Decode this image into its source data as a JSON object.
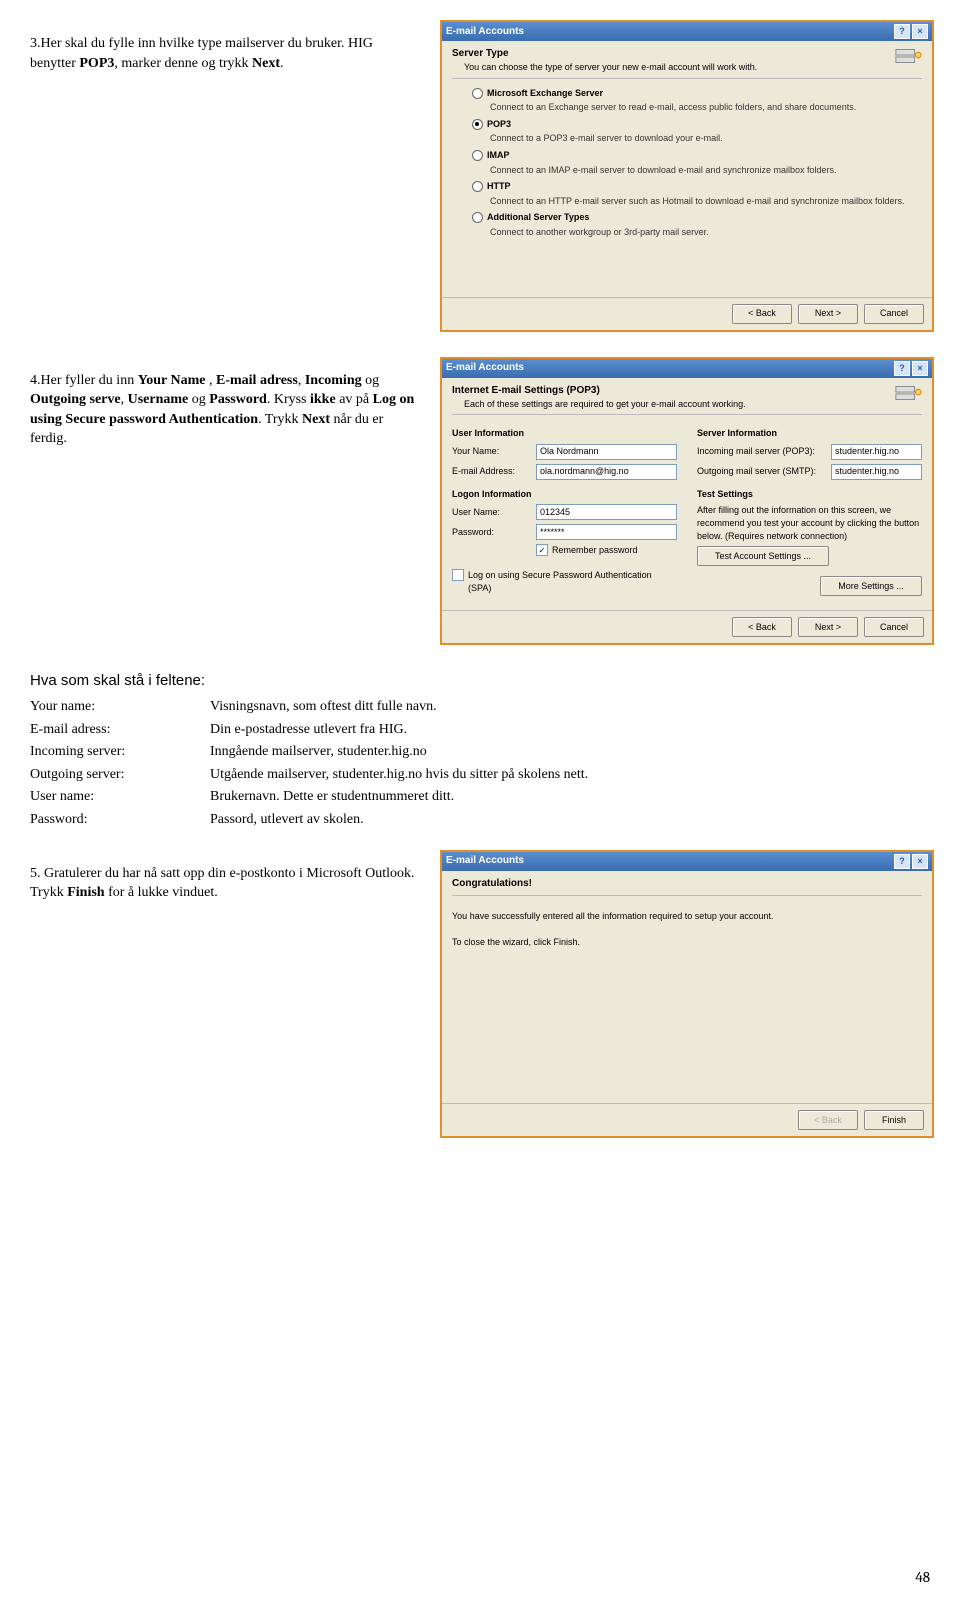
{
  "step3": {
    "prefix": "3.",
    "text_a": "Her skal du fylle inn hvilke type mailserver du bruker. HIG benytter ",
    "pop3": "POP3",
    "text_b": ", marker denne og trykk ",
    "next": "Next",
    "text_c": "."
  },
  "step4": {
    "prefix": "4.",
    "text_a": "Her fyller du inn ",
    "your_name": "Your Name",
    "text_b": " , ",
    "email": "E-mail adress",
    "text_c": ", ",
    "incoming": "Incoming",
    "text_d": " og ",
    "outgoing": "Outgoing serve",
    "text_e": ", ",
    "username": "Username",
    "text_f": " og ",
    "password": "Password",
    "text_g": ". Kryss ",
    "ikke": "ikke",
    "text_h": " av på ",
    "log_on": "Log on using Secure password Authentication",
    "text_i": ". Trykk ",
    "next": "Next",
    "text_j": " når du er ferdig."
  },
  "step5": {
    "prefix": "5.",
    "text_a": " Gratulerer du har nå satt opp din e-postkonto i Microsoft Outlook. Trykk ",
    "finish": "Finish",
    "text_b": " for å lukke vinduet."
  },
  "fields_heading": "Hva som skal stå i feltene:",
  "fields": [
    {
      "k": "Your name:",
      "v": "Visningsnavn, som oftest ditt fulle navn."
    },
    {
      "k": "E-mail adress:",
      "v": "Din e-postadresse utlevert fra HIG."
    },
    {
      "k": "Incoming server:",
      "v": "Inngående mailserver, studenter.hig.no"
    },
    {
      "k": "Outgoing server:",
      "v": "Utgående mailserver, studenter.hig.no hvis du sitter på skolens nett."
    },
    {
      "k": "User name:",
      "v": "Brukernavn. Dette er studentnummeret ditt."
    },
    {
      "k": "Password:",
      "v": "Passord, utlevert av skolen."
    }
  ],
  "dialog": {
    "title": "E-mail Accounts",
    "help": "?",
    "close": "×",
    "back": "< Back",
    "next": "Next >",
    "cancel": "Cancel",
    "finish": "Finish"
  },
  "dlg1": {
    "heading": "Server Type",
    "sub": "You can choose the type of server your new e-mail account will work with.",
    "opts": [
      {
        "label": "Microsoft Exchange Server",
        "desc": "Connect to an Exchange server to read e-mail, access public folders, and share documents.",
        "checked": false
      },
      {
        "label": "POP3",
        "desc": "Connect to a POP3 e-mail server to download your e-mail.",
        "checked": true
      },
      {
        "label": "IMAP",
        "desc": "Connect to an IMAP e-mail server to download e-mail and synchronize mailbox folders.",
        "checked": false
      },
      {
        "label": "HTTP",
        "desc": "Connect to an HTTP e-mail server such as Hotmail to download e-mail and synchronize mailbox folders.",
        "checked": false
      },
      {
        "label": "Additional Server Types",
        "desc": "Connect to another workgroup or 3rd-party mail server.",
        "checked": false
      }
    ]
  },
  "dlg2": {
    "heading": "Internet E-mail Settings (POP3)",
    "sub": "Each of these settings are required to get your e-mail account working.",
    "user_info": "User Information",
    "your_name_lbl": "Your Name:",
    "your_name_val": "Ola Nordmann",
    "email_lbl": "E-mail Address:",
    "email_val": "ola.nordmann@hig.no",
    "server_info": "Server Information",
    "pop_lbl": "Incoming mail server (POP3):",
    "pop_val": "studenter.hig.no",
    "smtp_lbl": "Outgoing mail server (SMTP):",
    "smtp_val": "studenter.hig.no",
    "logon_info": "Logon Information",
    "user_lbl": "User Name:",
    "user_val": "012345",
    "pass_lbl": "Password:",
    "pass_val": "*******",
    "remember": "Remember password",
    "spa": "Log on using Secure Password Authentication (SPA)",
    "test_settings": "Test Settings",
    "test_text": "After filling out the information on this screen, we recommend you test your account by clicking the button below. (Requires network connection)",
    "test_btn": "Test Account Settings ...",
    "more": "More Settings ..."
  },
  "dlg3": {
    "heading": "Congratulations!",
    "line1": "You have successfully entered all the information required to setup your account.",
    "line2": "To close the wizard, click Finish."
  },
  "page_number": "48"
}
